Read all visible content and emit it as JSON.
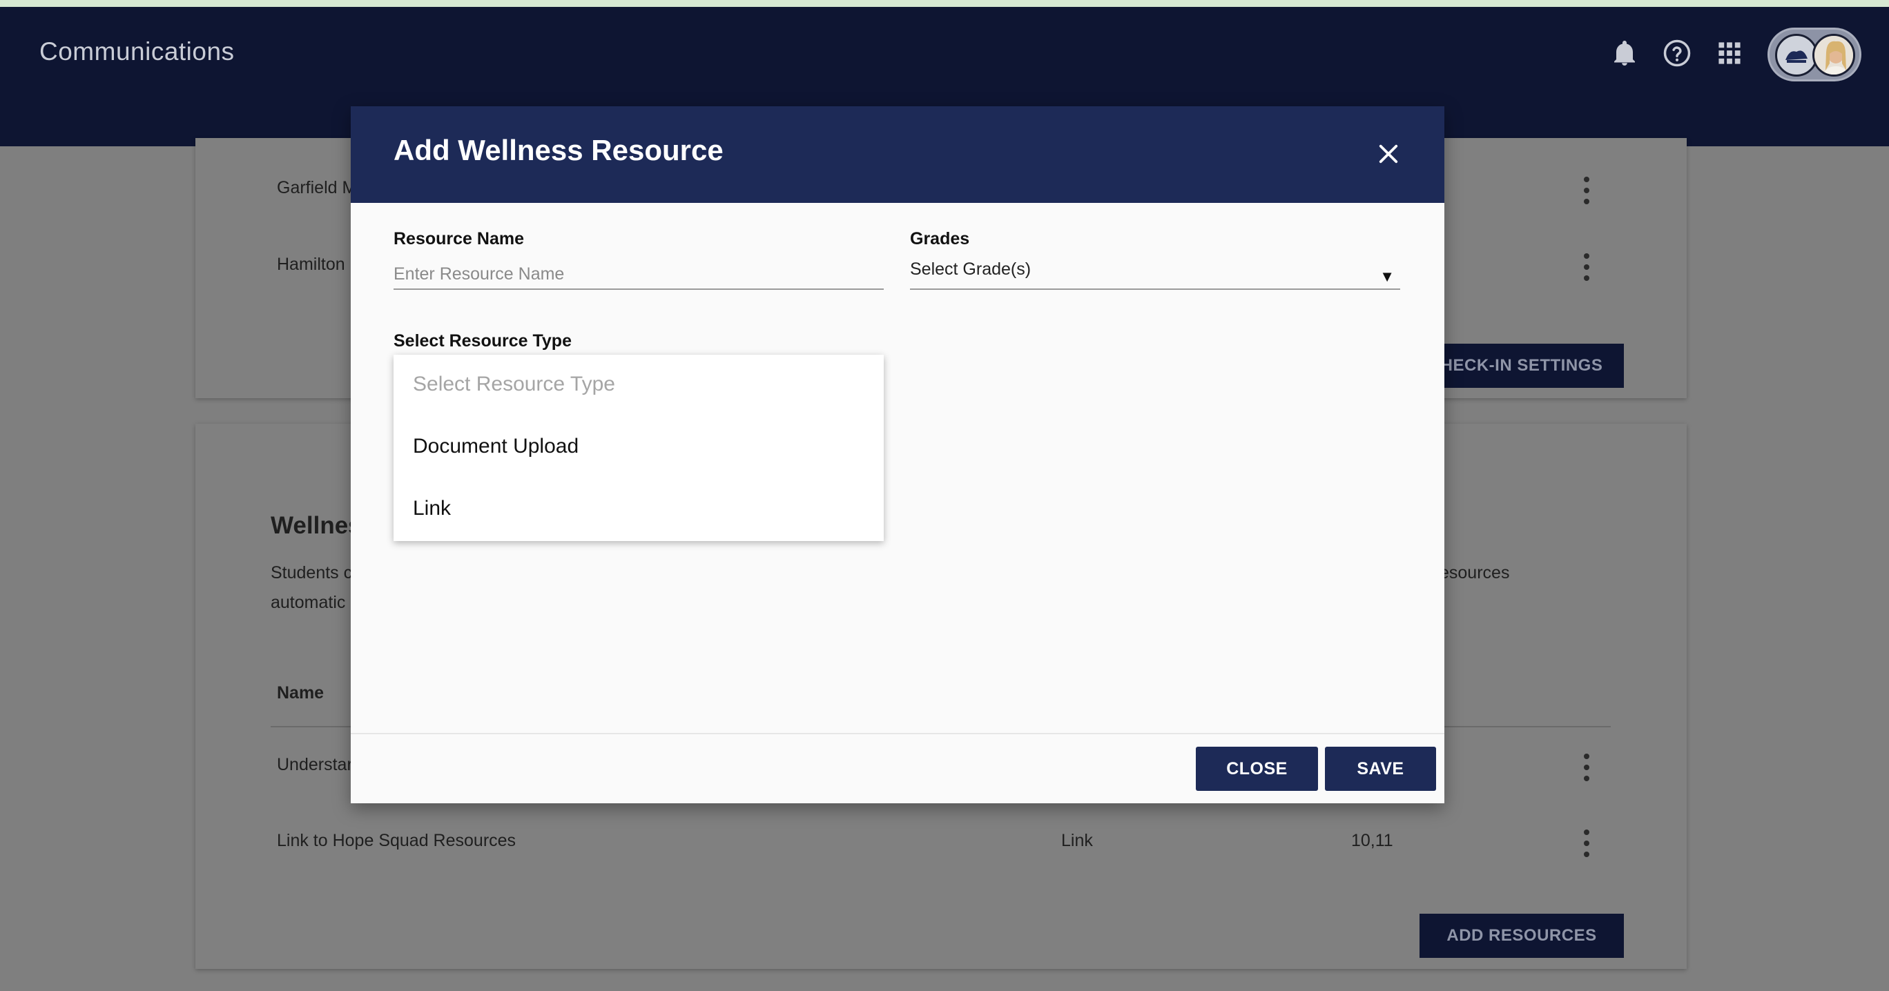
{
  "app": {
    "title": "Communications"
  },
  "header_icons": [
    "bell-icon",
    "help-icon",
    "apps-grid-icon"
  ],
  "background": {
    "card1": {
      "rows": [
        {
          "name": "Garfield M"
        },
        {
          "name": "Hamilton"
        }
      ],
      "button_label": "HECK-IN SETTINGS"
    },
    "card2": {
      "title": "Welln­es",
      "desc_line1_left": "Students c",
      "desc_line1_right": "esources",
      "desc_line2_left": "automatic",
      "column_name": "Name",
      "rows": [
        {
          "name": "Understar",
          "type": "",
          "grades": ""
        },
        {
          "name": "Link to Hope Squad Resources",
          "type": "Link",
          "grades": "10,11"
        }
      ],
      "button_label": "ADD RESOURCES"
    }
  },
  "modal": {
    "title": "Add Wellness Resource",
    "resource_name": {
      "label": "Resource Name",
      "placeholder": "Enter Resource Name",
      "value": ""
    },
    "grades": {
      "label": "Grades",
      "selected": "Select Grade(s)"
    },
    "resource_type": {
      "label": "Select Resource Type",
      "options": [
        "Select Resource Type",
        "Document Upload",
        "Link"
      ]
    },
    "buttons": {
      "close": "CLOSE",
      "save": "SAVE"
    }
  },
  "colors": {
    "appbar": "#0e1532",
    "modal_header": "#1d2a57",
    "overlay_grey": "#7f7f7f"
  }
}
